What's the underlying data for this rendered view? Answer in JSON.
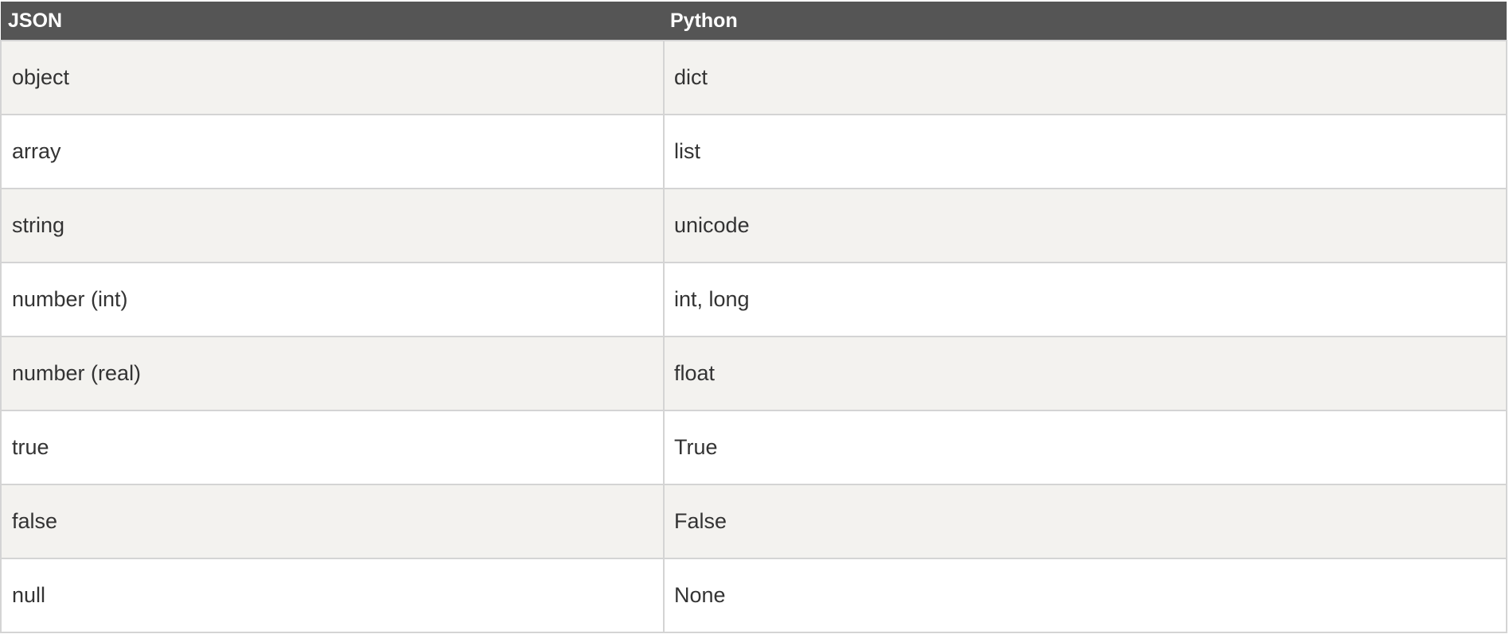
{
  "table": {
    "headers": [
      "JSON",
      "Python"
    ],
    "rows": [
      [
        "object",
        "dict"
      ],
      [
        "array",
        "list"
      ],
      [
        "string",
        "unicode"
      ],
      [
        "number (int)",
        "int, long"
      ],
      [
        "number (real)",
        "float"
      ],
      [
        "true",
        "True"
      ],
      [
        "false",
        "False"
      ],
      [
        "null",
        "None"
      ]
    ]
  },
  "colors": {
    "header_bg": "#555555",
    "header_text": "#ffffff",
    "row_odd_bg": "#f3f2ef",
    "row_even_bg": "#ffffff",
    "border": "#d4d4d4",
    "text": "#333333"
  }
}
